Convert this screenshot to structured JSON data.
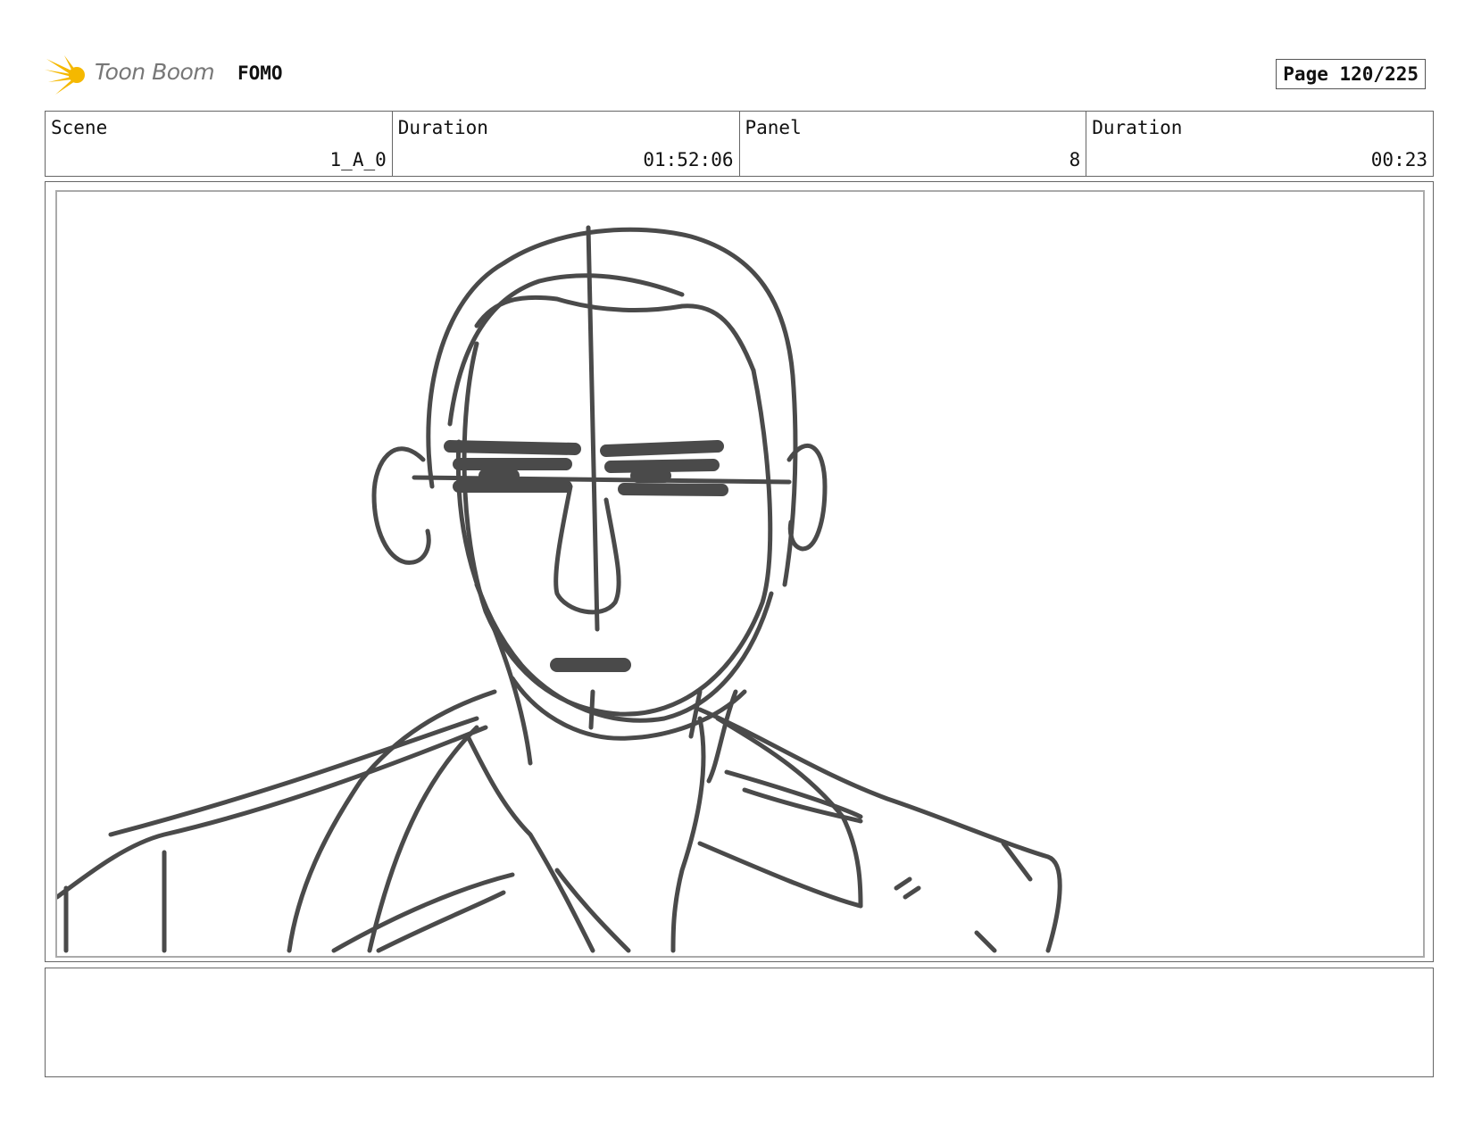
{
  "header": {
    "logo_text": "Toon Boom",
    "project_title": "FOMO",
    "page_label": "Page 120/225"
  },
  "info": {
    "scene_label": "Scene",
    "scene_value": "1_A_0",
    "scene_duration_label": "Duration",
    "scene_duration_value": "01:52:06",
    "panel_label": "Panel",
    "panel_value": "8",
    "panel_duration_label": "Duration",
    "panel_duration_value": "00:23"
  },
  "colors": {
    "sketch_stroke": "#4a4a4a",
    "logo_accent": "#f5b800"
  },
  "icons": [
    "toon-boom-logo-icon"
  ]
}
